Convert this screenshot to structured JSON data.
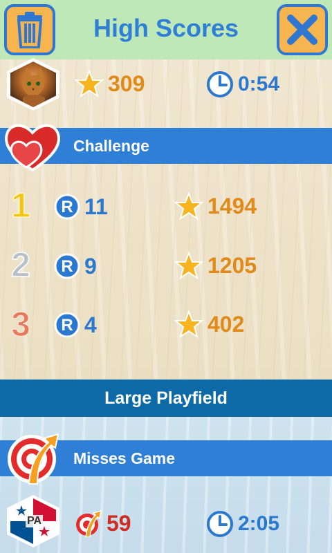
{
  "header": {
    "title": "High Scores",
    "left_icon": "trash-icon",
    "right_icon": "close-icon"
  },
  "top_row": {
    "stars": "309",
    "time": "0:54"
  },
  "challenge": {
    "label": "Challenge",
    "rows": [
      {
        "rank": "1",
        "rounds": "11",
        "stars": "1494"
      },
      {
        "rank": "2",
        "rounds": "9",
        "stars": "1205"
      },
      {
        "rank": "3",
        "rounds": "4",
        "stars": "402"
      }
    ]
  },
  "large_playfield": {
    "label": "Large Playfield"
  },
  "misses": {
    "label": "Misses Game",
    "misses": "59",
    "time": "2:05",
    "flag_code": "PA"
  },
  "colors": {
    "header_bg": "#bfe8b8",
    "section_blue": "#2f7fd6",
    "large_bar": "#0e6aa6",
    "star_orange": "#e08a1a",
    "text_blue": "#2a78d0",
    "miss_red": "#cf2b22"
  }
}
